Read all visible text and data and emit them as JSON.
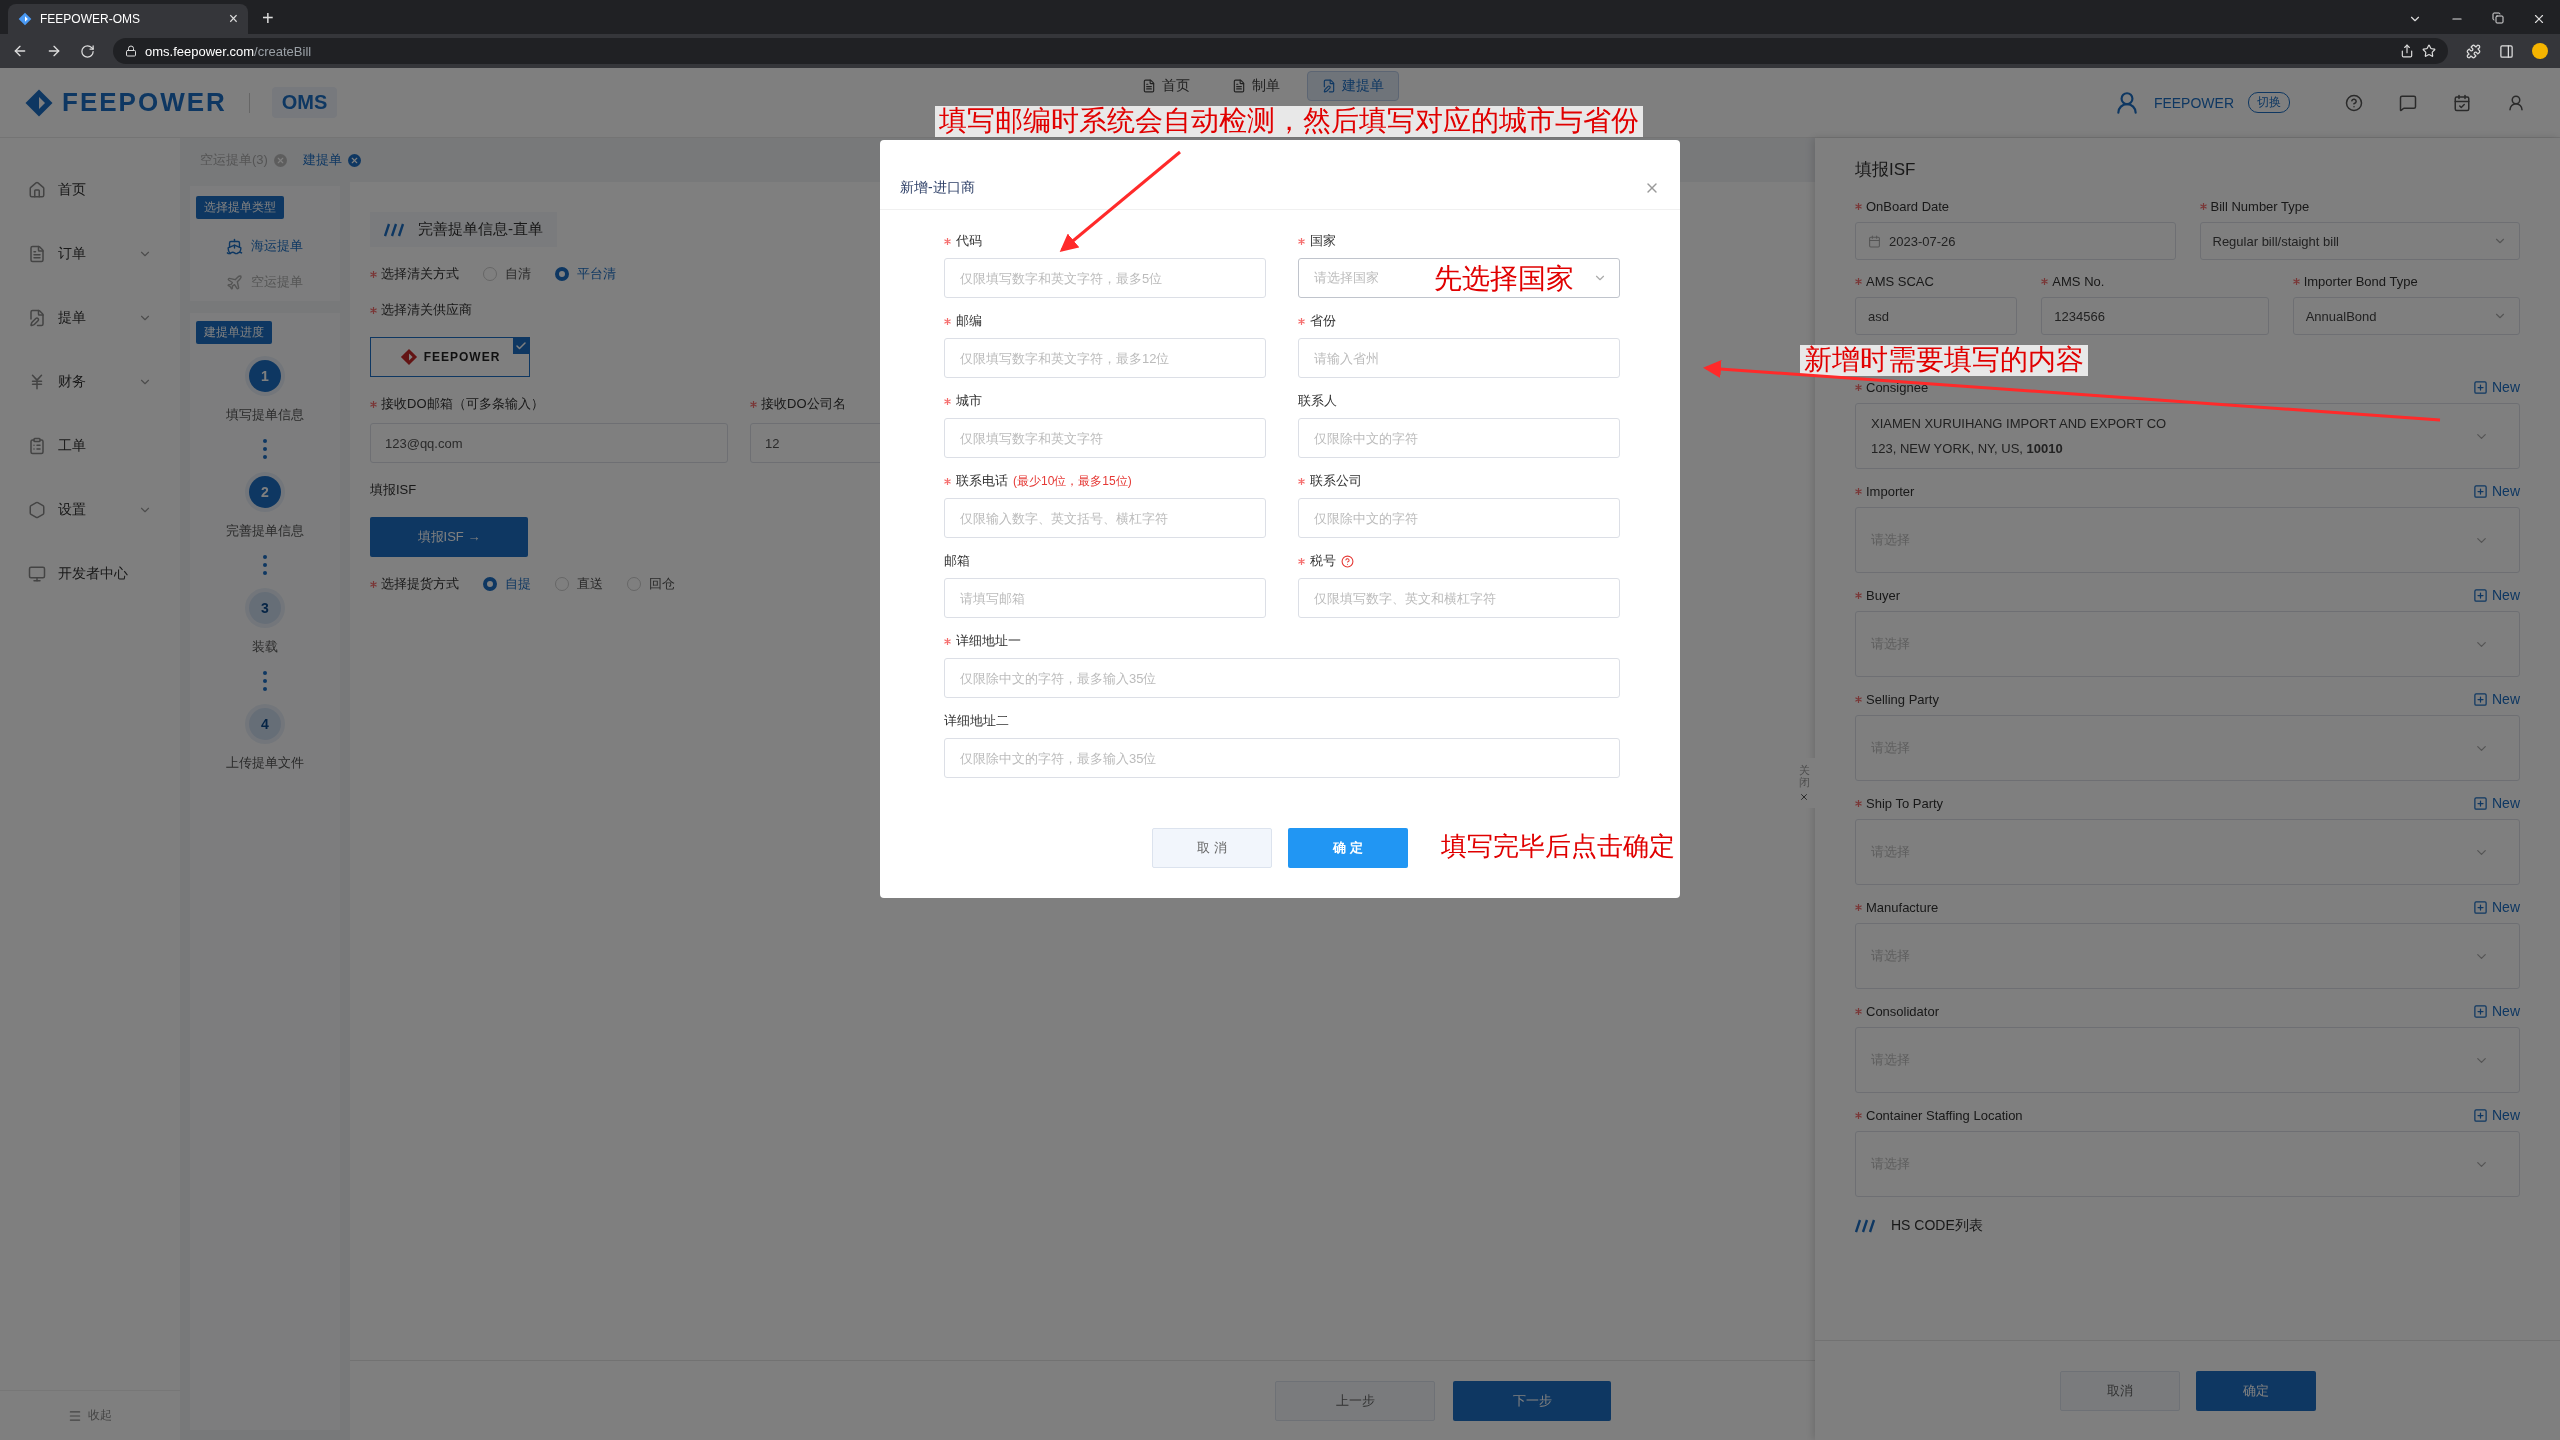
{
  "browser": {
    "tab_title": "FEEPOWER-OMS",
    "tab_close": "×",
    "new_tab": "+",
    "url_host": "oms.feepower.com",
    "url_path": "/createBill"
  },
  "header": {
    "brand": "FEEPOWER",
    "product": "OMS",
    "nav": [
      {
        "label": "首页",
        "selected": false
      },
      {
        "label": "制单",
        "selected": false
      },
      {
        "label": "建提单",
        "selected": true
      }
    ],
    "user": "FEEPOWER",
    "switch": "切换"
  },
  "sidebar": {
    "items": [
      {
        "label": "首页",
        "has_children": false
      },
      {
        "label": "订单",
        "has_children": true
      },
      {
        "label": "提单",
        "has_children": true
      },
      {
        "label": "财务",
        "has_children": true
      },
      {
        "label": "工单",
        "has_children": false
      },
      {
        "label": "设置",
        "has_children": true
      },
      {
        "label": "开发者中心",
        "has_children": false
      }
    ],
    "collapse": "收起"
  },
  "page_tabs": [
    {
      "label": "空运提单(3)",
      "selected": false
    },
    {
      "label": "建提单",
      "selected": true
    }
  ],
  "steps_panel": {
    "type_badge": "选择提单类型",
    "types": [
      {
        "label": "海运提单",
        "selected": true
      },
      {
        "label": "空运提单",
        "selected": false
      }
    ],
    "progress_badge": "建提单进度",
    "steps": [
      {
        "number": "1",
        "label": "填写提单信息",
        "active": true
      },
      {
        "number": "2",
        "label": "完善提单信息",
        "active": true
      },
      {
        "number": "3",
        "label": "装载",
        "active": false
      },
      {
        "number": "4",
        "label": "上传提单文件",
        "active": false
      }
    ]
  },
  "form": {
    "title": "完善提单信息-直单",
    "clearance": {
      "label": "选择清关方式",
      "options": [
        {
          "label": "自清",
          "selected": false
        },
        {
          "label": "平台清",
          "selected": true
        }
      ]
    },
    "supplier": {
      "label": "选择清关供应商",
      "name": "FEEPOWER",
      "selected": true
    },
    "do_email": {
      "label": "接收DO邮箱（可多条输入）",
      "value": "123@qq.com"
    },
    "do_company": {
      "label": "接收DO公司名",
      "value": "12"
    },
    "isf": {
      "label": "填报ISF",
      "button": "填报ISF →"
    },
    "delivery": {
      "label": "选择提货方式",
      "options": [
        {
          "label": "自提",
          "selected": true
        },
        {
          "label": "直送",
          "selected": false
        },
        {
          "label": "回仓",
          "selected": false
        }
      ]
    }
  },
  "footer": {
    "prev": "上一步",
    "next": "下一步"
  },
  "isf_drawer": {
    "title": "填报ISF",
    "close_tab": "关闭",
    "row1": [
      {
        "label": "OnBoard Date",
        "kind": "date",
        "value": "2023-07-26"
      },
      {
        "label": "Bill Number Type",
        "kind": "select",
        "value": "Regular bill/staight bill"
      }
    ],
    "row2": [
      {
        "label": "AMS SCAC",
        "kind": "text",
        "value": "asd"
      },
      {
        "label": "AMS No.",
        "kind": "text",
        "value": "1234566"
      },
      {
        "label": "Importer Bond Type",
        "kind": "select",
        "value": "AnnualBond"
      }
    ],
    "parties": [
      {
        "label": "Consignee",
        "new": "New",
        "line1": "XIAMEN XURUIHANG IMPORT AND EXPORT CO",
        "line2": "123, NEW YORK, NY, US, **10010**"
      },
      {
        "label": "Importer",
        "new": "New",
        "placeholder": "请选择"
      },
      {
        "label": "Buyer",
        "new": "New",
        "placeholder": "请选择"
      },
      {
        "label": "Selling Party",
        "new": "New",
        "placeholder": "请选择"
      },
      {
        "label": "Ship To Party",
        "new": "New",
        "placeholder": "请选择"
      },
      {
        "label": "Manufacture",
        "new": "New",
        "placeholder": "请选择"
      },
      {
        "label": "Consolidator",
        "new": "New",
        "placeholder": "请选择"
      },
      {
        "label": "Container Staffing Location",
        "new": "New",
        "placeholder": "请选择"
      }
    ],
    "hs_title": "HS CODE列表",
    "cancel": "取消",
    "confirm": "确定"
  },
  "modal": {
    "title": "新增-进口商",
    "fields": [
      {
        "label": "代码",
        "required": true,
        "kind": "input",
        "placeholder": "仅限填写数字和英文字符，最多5位"
      },
      {
        "label": "国家",
        "required": true,
        "kind": "select",
        "placeholder": "请选择国家"
      },
      {
        "label": "邮编",
        "required": true,
        "kind": "input",
        "placeholder": "仅限填写数字和英文字符，最多12位"
      },
      {
        "label": "省份",
        "required": true,
        "kind": "input",
        "placeholder": "请输入省州"
      },
      {
        "label": "城市",
        "required": true,
        "kind": "input",
        "placeholder": "仅限填写数字和英文字符"
      },
      {
        "label": "联系人",
        "required": false,
        "kind": "input",
        "placeholder": "仅限除中文的字符"
      },
      {
        "label": "联系电话",
        "hint": "(最少10位，最多15位)",
        "required": true,
        "kind": "input",
        "placeholder": "仅限输入数字、英文括号、横杠字符"
      },
      {
        "label": "联系公司",
        "required": true,
        "kind": "input",
        "placeholder": "仅限除中文的字符"
      },
      {
        "label": "邮箱",
        "required": false,
        "kind": "input",
        "placeholder": "请填写邮箱"
      },
      {
        "label": "税号",
        "required": true,
        "help": true,
        "kind": "input",
        "placeholder": "仅限填写数字、英文和横杠字符"
      },
      {
        "label": "详细地址一",
        "required": true,
        "kind": "wide",
        "placeholder": "仅限除中文的字符，最多输入35位"
      },
      {
        "label": "详细地址二",
        "required": false,
        "kind": "wide",
        "placeholder": "仅限除中文的字符，最多输入35位"
      }
    ],
    "cancel": "取 消",
    "confirm": "确 定"
  },
  "annotations": [
    {
      "text": "填写邮编时系统会自动检测，然后填写对应的城市与省份"
    },
    {
      "text": "先选择国家"
    },
    {
      "text": "新增时需要填写的内容"
    },
    {
      "text": "填写完毕后点击确定"
    }
  ]
}
